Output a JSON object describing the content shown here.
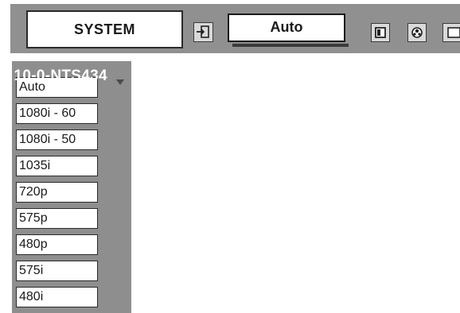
{
  "menu": {
    "system_label": "SYSTEM",
    "auto_value": "Auto"
  },
  "list": {
    "items": [
      {
        "label": "Auto"
      },
      {
        "label": "1080i - 60"
      },
      {
        "label": "1080i - 50"
      },
      {
        "label": "1035i"
      },
      {
        "label": "720p"
      },
      {
        "label": "575p"
      },
      {
        "label": "480p"
      },
      {
        "label": "575i"
      },
      {
        "label": "480i"
      }
    ]
  },
  "overlay": {
    "text": "n 10-0-NTS434"
  },
  "colors": {
    "bar_gray": "#909090",
    "panel_gray": "#8e8e8e",
    "item_bg": "#ffffff",
    "text": "#1a1a1a"
  },
  "icons": {
    "enter": "input-enter-icon",
    "square": "square-icon",
    "color": "color-swatch-icon",
    "edge": "menu-edge-icon",
    "scroll": "scroll-down-icon"
  }
}
